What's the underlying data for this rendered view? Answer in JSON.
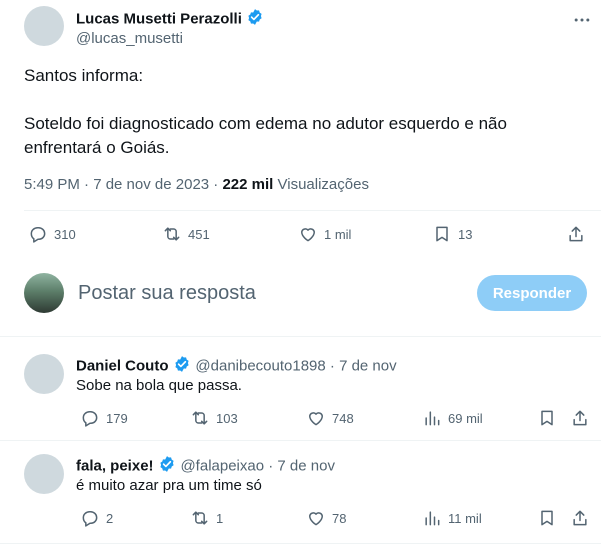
{
  "tweet": {
    "author_name": "Lucas Musetti Perazolli",
    "author_handle": "@lucas_musetti",
    "text_line1": "Santos informa:",
    "text_line2": "Soteldo foi diagnosticado com edema no adutor esquerdo e não",
    "text_line3": "enfrentará o Goiás.",
    "time": "5:49 PM · 7 de nov de 2023 · ",
    "views_count": "222 mil",
    "views_label": " Visualizações",
    "replies": "310",
    "retweets": "451",
    "likes": "1 mil",
    "bookmarks": "13"
  },
  "compose": {
    "placeholder": "Postar sua resposta",
    "button_label": "Responder"
  },
  "replies": [
    {
      "name": "Daniel Couto",
      "handle": "@danibecouto1898 · 7 de nov",
      "text": "Sobe na bola que passa.",
      "replies": "179",
      "retweets": "103",
      "likes": "748",
      "views": "69 mil"
    },
    {
      "name": "fala, peixe!",
      "handle": "@falapeixao · 7 de nov",
      "text": "é muito azar pra um time só",
      "replies": "2",
      "retweets": "1",
      "likes": "78",
      "views": "11 mil"
    }
  ],
  "colors": {
    "verified": "#1d9bf0",
    "reply_button": "#8ecdf7",
    "secondary_text": "#536471"
  }
}
